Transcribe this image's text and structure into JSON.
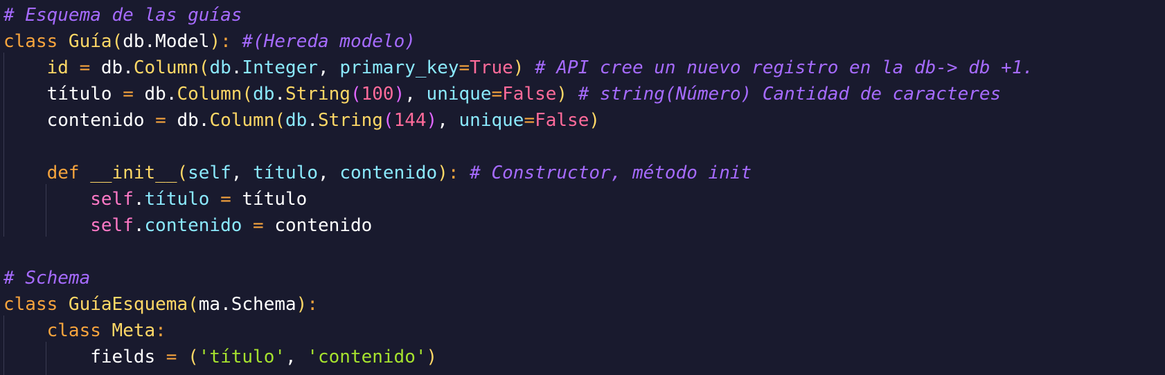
{
  "editor": {
    "language": "python",
    "lines": [
      {
        "tokens": [
          {
            "t": "comment",
            "v": "# Esquema de las guías"
          }
        ]
      },
      {
        "tokens": [
          {
            "t": "kw",
            "v": "class "
          },
          {
            "t": "cls",
            "v": "Guía"
          },
          {
            "t": "bracket",
            "v": "("
          },
          {
            "t": "plain",
            "v": "db"
          },
          {
            "t": "plain",
            "v": "."
          },
          {
            "t": "plain",
            "v": "Model"
          },
          {
            "t": "bracket",
            "v": ")"
          },
          {
            "t": "punct",
            "v": ": "
          },
          {
            "t": "comment",
            "v": "#(Hereda modelo)"
          }
        ]
      },
      {
        "tokens": [
          {
            "t": "plain",
            "v": "    "
          },
          {
            "t": "attr",
            "v": "id"
          },
          {
            "t": "op",
            "v": " = "
          },
          {
            "t": "plain",
            "v": "db."
          },
          {
            "t": "attr",
            "v": "Column"
          },
          {
            "t": "bracket",
            "v": "("
          },
          {
            "t": "param",
            "v": "db"
          },
          {
            "t": "plain",
            "v": "."
          },
          {
            "t": "param",
            "v": "Integer"
          },
          {
            "t": "plain",
            "v": ", "
          },
          {
            "t": "param",
            "v": "primary_key"
          },
          {
            "t": "op",
            "v": "="
          },
          {
            "t": "bool",
            "v": "True"
          },
          {
            "t": "bracket",
            "v": ")"
          },
          {
            "t": "plain",
            "v": " "
          },
          {
            "t": "comment",
            "v": "# API cree un nuevo registro en la db-> db +1."
          }
        ]
      },
      {
        "tokens": [
          {
            "t": "plain",
            "v": "    "
          },
          {
            "t": "plain",
            "v": "título"
          },
          {
            "t": "op",
            "v": " = "
          },
          {
            "t": "plain",
            "v": "db."
          },
          {
            "t": "attr",
            "v": "Column"
          },
          {
            "t": "bracket",
            "v": "("
          },
          {
            "t": "param",
            "v": "db"
          },
          {
            "t": "plain",
            "v": "."
          },
          {
            "t": "attr",
            "v": "String"
          },
          {
            "t": "bracket2",
            "v": "("
          },
          {
            "t": "num",
            "v": "100"
          },
          {
            "t": "bracket2",
            "v": ")"
          },
          {
            "t": "plain",
            "v": ", "
          },
          {
            "t": "param",
            "v": "unique"
          },
          {
            "t": "op",
            "v": "="
          },
          {
            "t": "bool",
            "v": "False"
          },
          {
            "t": "bracket",
            "v": ")"
          },
          {
            "t": "plain",
            "v": " "
          },
          {
            "t": "comment",
            "v": "# string(Número) Cantidad de caracteres"
          }
        ]
      },
      {
        "tokens": [
          {
            "t": "plain",
            "v": "    "
          },
          {
            "t": "plain",
            "v": "contenido"
          },
          {
            "t": "op",
            "v": " = "
          },
          {
            "t": "plain",
            "v": "db."
          },
          {
            "t": "attr",
            "v": "Column"
          },
          {
            "t": "bracket",
            "v": "("
          },
          {
            "t": "param",
            "v": "db"
          },
          {
            "t": "plain",
            "v": "."
          },
          {
            "t": "attr",
            "v": "String"
          },
          {
            "t": "bracket2",
            "v": "("
          },
          {
            "t": "num",
            "v": "144"
          },
          {
            "t": "bracket2",
            "v": ")"
          },
          {
            "t": "plain",
            "v": ", "
          },
          {
            "t": "param",
            "v": "unique"
          },
          {
            "t": "op",
            "v": "="
          },
          {
            "t": "bool",
            "v": "False"
          },
          {
            "t": "bracket",
            "v": ")"
          }
        ]
      },
      {
        "tokens": []
      },
      {
        "tokens": [
          {
            "t": "plain",
            "v": "    "
          },
          {
            "t": "kw",
            "v": "def "
          },
          {
            "t": "attr",
            "v": "__init__"
          },
          {
            "t": "bracket",
            "v": "("
          },
          {
            "t": "param",
            "v": "self"
          },
          {
            "t": "plain",
            "v": ", "
          },
          {
            "t": "param",
            "v": "título"
          },
          {
            "t": "plain",
            "v": ", "
          },
          {
            "t": "param",
            "v": "contenido"
          },
          {
            "t": "bracket",
            "v": ")"
          },
          {
            "t": "punct",
            "v": ": "
          },
          {
            "t": "comment",
            "v": "# Constructor, método init"
          }
        ]
      },
      {
        "tokens": [
          {
            "t": "plain",
            "v": "        "
          },
          {
            "t": "self",
            "v": "self"
          },
          {
            "t": "plain",
            "v": "."
          },
          {
            "t": "param",
            "v": "título"
          },
          {
            "t": "op",
            "v": " = "
          },
          {
            "t": "plain",
            "v": "título"
          }
        ]
      },
      {
        "tokens": [
          {
            "t": "plain",
            "v": "        "
          },
          {
            "t": "self",
            "v": "self"
          },
          {
            "t": "plain",
            "v": "."
          },
          {
            "t": "param",
            "v": "contenido"
          },
          {
            "t": "op",
            "v": " = "
          },
          {
            "t": "plain",
            "v": "contenido"
          }
        ]
      },
      {
        "tokens": []
      },
      {
        "tokens": [
          {
            "t": "comment",
            "v": "# Schema"
          }
        ]
      },
      {
        "tokens": [
          {
            "t": "kw",
            "v": "class "
          },
          {
            "t": "cls",
            "v": "GuíaEsquema"
          },
          {
            "t": "bracket",
            "v": "("
          },
          {
            "t": "plain",
            "v": "ma"
          },
          {
            "t": "plain",
            "v": "."
          },
          {
            "t": "plain",
            "v": "Schema"
          },
          {
            "t": "bracket",
            "v": ")"
          },
          {
            "t": "punct",
            "v": ":"
          }
        ]
      },
      {
        "tokens": [
          {
            "t": "plain",
            "v": "    "
          },
          {
            "t": "kw",
            "v": "class "
          },
          {
            "t": "cls",
            "v": "Meta"
          },
          {
            "t": "punct",
            "v": ":"
          }
        ]
      },
      {
        "tokens": [
          {
            "t": "plain",
            "v": "        "
          },
          {
            "t": "plain",
            "v": "fields"
          },
          {
            "t": "op",
            "v": " = "
          },
          {
            "t": "bracket",
            "v": "("
          },
          {
            "t": "str",
            "v": "'título'"
          },
          {
            "t": "plain",
            "v": ", "
          },
          {
            "t": "str",
            "v": "'contenido'"
          },
          {
            "t": "bracket",
            "v": ")"
          }
        ]
      }
    ]
  }
}
